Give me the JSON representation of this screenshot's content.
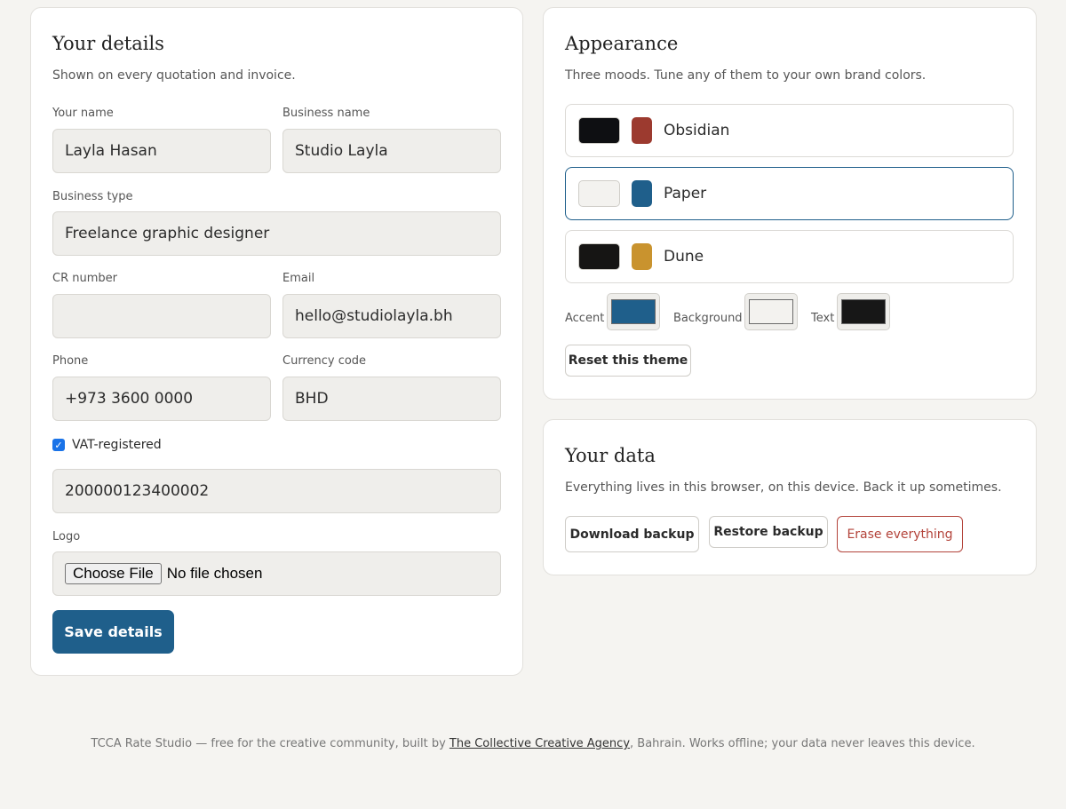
{
  "details": {
    "title": "Your details",
    "subtitle": "Shown on every quotation and invoice.",
    "your_name_label": "Your name",
    "your_name_value": "Layla Hasan",
    "business_name_label": "Business name",
    "business_name_value": "Studio Layla",
    "business_type_label": "Business type",
    "business_type_value": "Freelance graphic designer",
    "cr_label": "CR number",
    "cr_value": "",
    "email_label": "Email",
    "email_value": "hello@studiolayla.bh",
    "phone_label": "Phone",
    "phone_value": "+973 3600 0000",
    "currency_label": "Currency code",
    "currency_value": "BHD",
    "vat_label": "VAT-registered",
    "vat_checked": true,
    "vat_number": "200000123400002",
    "logo_label": "Logo",
    "file_button": "Choose File",
    "file_status": "No file chosen",
    "save_label": "Save details"
  },
  "appearance": {
    "title": "Appearance",
    "subtitle": "Three moods. Tune any of them to your own brand colors.",
    "themes": [
      {
        "name": "Obsidian",
        "bg": "#0e0f12",
        "accent": "#9c3a2f",
        "selected": false
      },
      {
        "name": "Paper",
        "bg": "#f3f2ef",
        "accent": "#1f5f8b",
        "selected": true
      },
      {
        "name": "Dune",
        "bg": "#161514",
        "accent": "#c9932e",
        "selected": false
      }
    ],
    "pickers": {
      "accent_label": "Accent",
      "accent_color": "#1f5f8b",
      "background_label": "Background",
      "background_color": "#f3f2ef",
      "text_label": "Text",
      "text_color": "#171717"
    },
    "reset_label": "Reset this theme"
  },
  "data_card": {
    "title": "Your data",
    "subtitle": "Everything lives in this browser, on this device. Back it up sometimes.",
    "download_label": "Download backup",
    "restore_label": "Restore backup",
    "erase_label": "Erase everything"
  },
  "footer": {
    "prefix": "TCCA Rate Studio — free for the creative community, built by",
    "link_text": "The Collective Creative Agency",
    "suffix": ", Bahrain. Works offline; your data never leaves this device."
  },
  "colors": {
    "primary": "#1f5f8b",
    "danger": "#b3433a",
    "page_bg": "#f5f4f1"
  }
}
